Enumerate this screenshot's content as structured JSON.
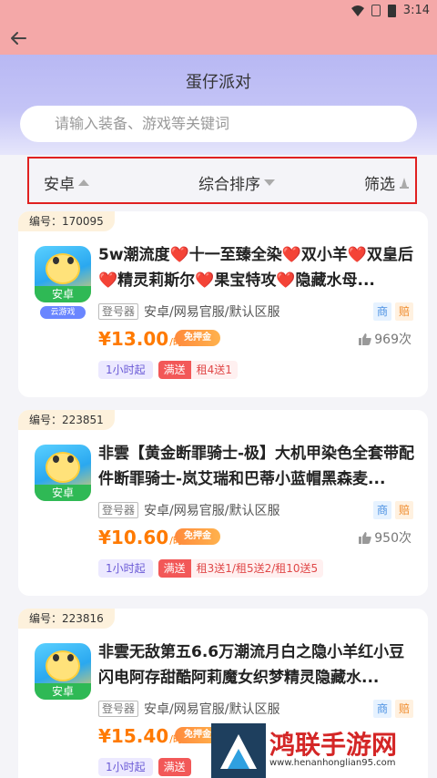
{
  "status_bar": {
    "time": "3:14"
  },
  "header": {
    "title": "蛋仔派对",
    "search_placeholder": "请输入装备、游戏等关键词"
  },
  "filters": [
    {
      "label": "安卓",
      "indicator": "triangle-up"
    },
    {
      "label": "综合排序",
      "indicator": "triangle-down"
    },
    {
      "label": "筛选",
      "indicator": "funnel-icon"
    }
  ],
  "listings": [
    {
      "id_label": "编号：170095",
      "title": "5w潮流度❤️十一至臻全染❤️双小羊❤️双皇后❤️精灵莉斯尔❤️果宝特攻❤️隐藏水母...",
      "icon_label": "安卓",
      "cloud_label": "云游戏",
      "login_label": "登号器",
      "server": "安卓/网易官服/默认区服",
      "tag_shang": "商",
      "tag_pei": "赔",
      "price": "¥13.00",
      "price_unit": "/时",
      "deposit_label": "免押金",
      "likes": "969次",
      "min_rent": "1小时起",
      "promo_label": "满送",
      "promo_detail": "租4送1"
    },
    {
      "id_label": "编号：223851",
      "title": "非雲【黄金断罪骑士-极】大机甲染色全套带配件断罪骑士-岚艾瑞和巴蒂小蓝帽黑森麦...",
      "icon_label": "安卓",
      "login_label": "登号器",
      "server": "安卓/网易官服/默认区服",
      "tag_shang": "商",
      "tag_pei": "赔",
      "price": "¥10.60",
      "price_unit": "/时",
      "deposit_label": "免押金",
      "likes": "950次",
      "min_rent": "1小时起",
      "promo_label": "满送",
      "promo_detail": "租3送1/租5送2/租10送5"
    },
    {
      "id_label": "编号：223816",
      "title": "非雲无敌第五6.6万潮流月白之隐小羊红小豆闪电阿存甜酷阿莉魔女织梦精灵隐藏水...",
      "icon_label": "安卓",
      "login_label": "登号器",
      "server": "安卓/网易官服/默认区服",
      "tag_shang": "商",
      "tag_pei": "赔",
      "price": "¥15.40",
      "price_unit": "/时",
      "deposit_label": "免押金",
      "min_rent": "1小时起",
      "promo_label": "满送"
    }
  ],
  "watermark": {
    "name": "鸿联手游网",
    "url": "www.henanhonglian95.com"
  },
  "colors": {
    "status_bar": "#f4a8a8",
    "header_gradient_top": "#b8b8f4",
    "price": "#ff7a00",
    "highlight_border": "#e02020"
  }
}
